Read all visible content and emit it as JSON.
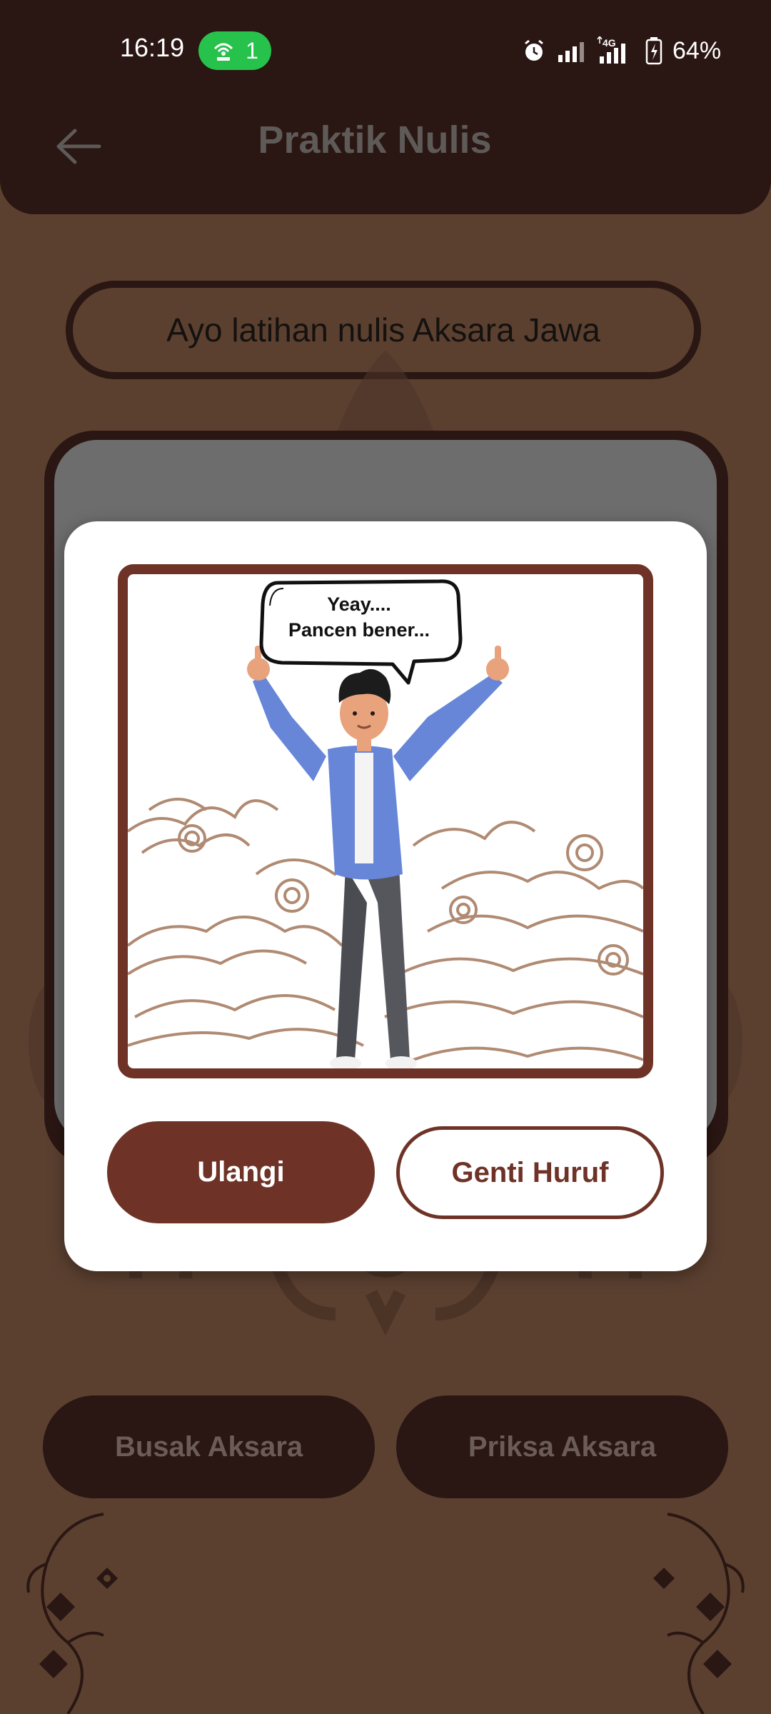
{
  "status_bar": {
    "time": "16:19",
    "hotspot_count": "1",
    "network": "4G",
    "battery": "64%"
  },
  "header": {
    "title": "Praktik Nulis",
    "back_icon": "arrow-left-icon"
  },
  "banner": {
    "text": "Ayo latihan nulis Aksara Jawa"
  },
  "bottom_buttons": {
    "erase_label": "Busak Aksara",
    "check_label": "Priksa Aksara"
  },
  "dialog": {
    "bubble_line1": "Yeay....",
    "bubble_line2": "Pancen bener...",
    "retry_label": "Ulangi",
    "change_letter_label": "Genti Huruf"
  },
  "colors": {
    "background": "#5b4030",
    "dark_brown": "#2a1612",
    "accent_brown": "#6e3326",
    "batik_line": "#b08a72",
    "hotspot_green": "#27c24c"
  }
}
